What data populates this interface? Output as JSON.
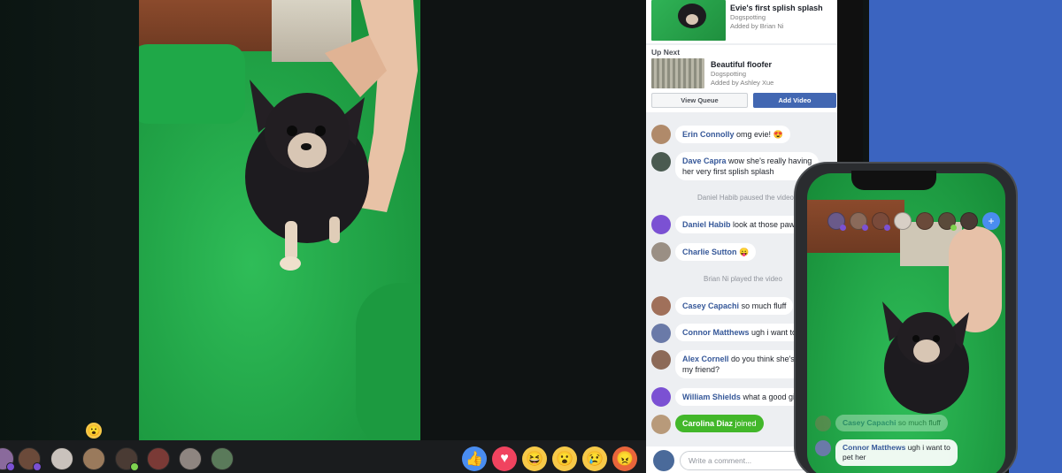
{
  "now_playing": {
    "title": "Evie's first splish splash",
    "group": "Dogspotting",
    "added_by": "Added by Brian Ni"
  },
  "up_next": {
    "label": "Up Next",
    "title": "Beautiful floofer",
    "group": "Dogspotting",
    "added_by": "Added by Ashley Xue",
    "view_queue_label": "View Queue",
    "add_video_label": "Add Video"
  },
  "chat": {
    "messages": [
      {
        "name": "Erin Connolly",
        "text": "omg evie! 😍"
      },
      {
        "name": "Dave Capra",
        "text": "wow she's really having",
        "text2": "her very first splish splash"
      },
      {
        "system": "Daniel Habib paused the video"
      },
      {
        "name": "Daniel Habib",
        "text": "look at those paws"
      },
      {
        "name": "Charlie Sutton",
        "text": "😛"
      },
      {
        "system": "Brian Ni played the video"
      },
      {
        "name": "Casey Capachi",
        "text": "so much fluff"
      },
      {
        "name": "Connor Matthews",
        "text": "ugh i want to"
      },
      {
        "name": "Alex Cornell",
        "text": "do you think she's",
        "text2": "my friend?"
      },
      {
        "name": "William Shields",
        "text": "what a good girl"
      }
    ],
    "joined": {
      "name": "Carolina Diaz",
      "text": "joined"
    },
    "compose_placeholder": "Write a comment..."
  },
  "reactions": [
    {
      "name": "like",
      "glyph": "👍",
      "color": "#4a8df0"
    },
    {
      "name": "love",
      "glyph": "♥",
      "color": "#f0435f"
    },
    {
      "name": "haha",
      "glyph": "😆",
      "color": "#f7c948"
    },
    {
      "name": "wow",
      "glyph": "😮",
      "color": "#f7c948"
    },
    {
      "name": "sad",
      "glyph": "😢",
      "color": "#f7c948"
    },
    {
      "name": "angry",
      "glyph": "😠",
      "color": "#e9653b"
    }
  ],
  "floating_reaction": "😮",
  "phone": {
    "messages": [
      {
        "name": "Casey Capachi",
        "text": "so much fluff"
      },
      {
        "name": "Connor Matthews",
        "text": "ugh i want to",
        "text2": "pet her"
      }
    ],
    "add_icon": "+"
  }
}
